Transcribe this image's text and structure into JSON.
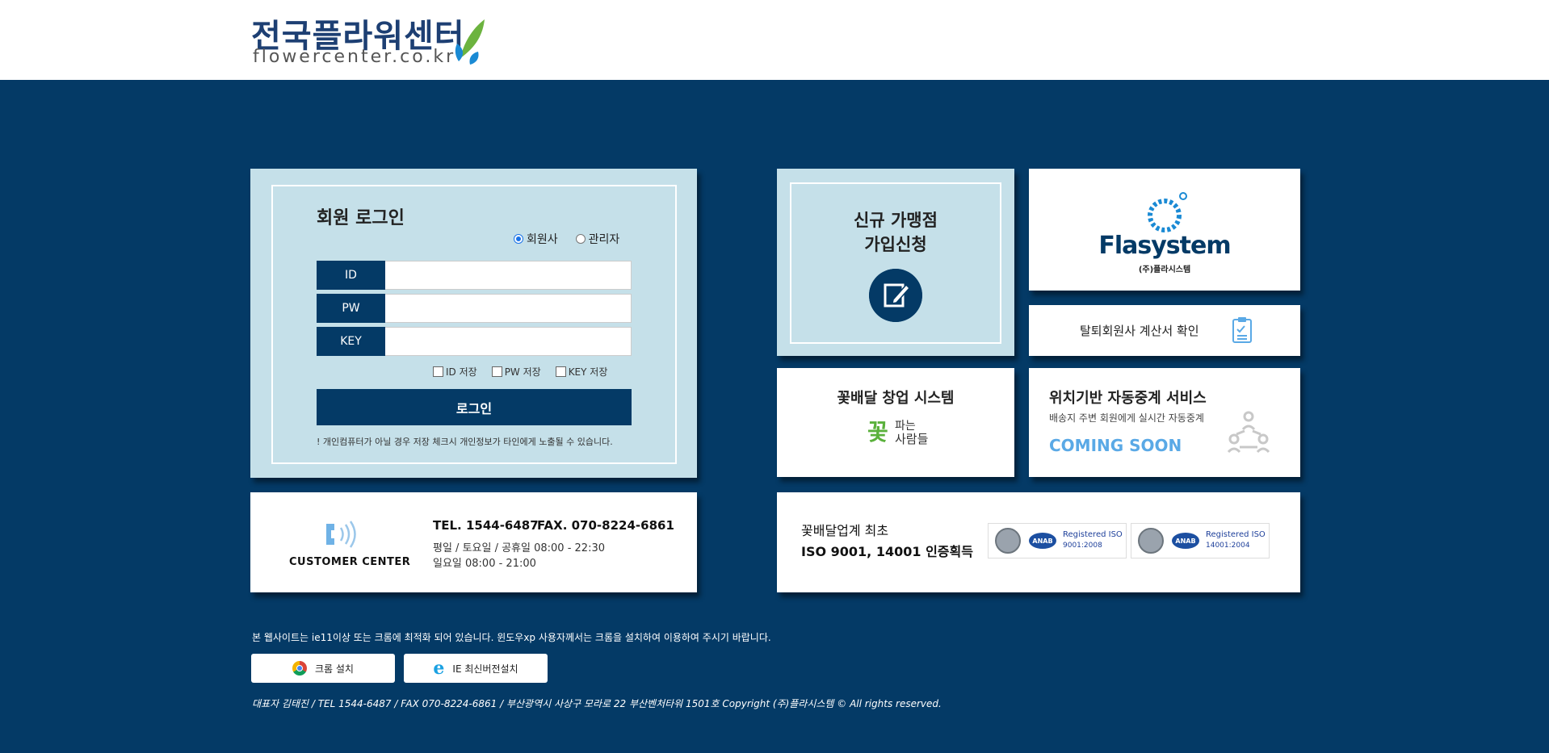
{
  "header": {
    "logo_ko": "전국플라워센터",
    "logo_en": "flowercenter.co.kr"
  },
  "login": {
    "title": "회원 로그인",
    "radio_member": "회원사",
    "radio_admin": "관리자",
    "selected_radio": "회원사",
    "id_label": "ID",
    "pw_label": "PW",
    "key_label": "KEY",
    "id_value": "",
    "pw_value": "",
    "key_value": "",
    "save_id": "ID 저장",
    "save_pw": "PW 저장",
    "save_key": "KEY 저장",
    "button": "로그인",
    "notice": "! 개인컴퓨터가 아닐 경우 저장 체크시 개인정보가 타인에게 노출될 수 있습니다."
  },
  "customer": {
    "label": "CUSTOMER CENTER",
    "tel": "TEL. 1544-6487",
    "fax": "FAX. 070-8224-6861",
    "hours1": "평일 / 토요일 / 공휴일 08:00 - 22:30",
    "hours2": "일요일 08:00 - 21:00"
  },
  "join": {
    "line1": "신규 가맹점",
    "line2": "가입신청"
  },
  "flasystem": {
    "name": "Flasystem",
    "sub": "(주)플라시스템"
  },
  "withdraw": {
    "label": "탈퇴회원사 계산서 확인"
  },
  "startup": {
    "title": "꽃배달 창업 시스템",
    "logo_big": "꽃",
    "logo_small1": "파는",
    "logo_small2": "사람들"
  },
  "location": {
    "title": "위치기반 자동중계 서비스",
    "subtitle": "배송지 주변 회원에게 실시간 자동중계",
    "status": "COMING SOON"
  },
  "iso": {
    "line1": "꽃배달업계 최초",
    "line2": "ISO 9001, 14001 인증획득",
    "badge1_title": "Registered ISO",
    "badge1_code": "9001:2008",
    "badge2_title": "Registered ISO",
    "badge2_code": "14001:2004",
    "anab": "ANAB"
  },
  "footer": {
    "notice": "본 웹사이트는 ie11이상 또는 크롬에 최적화 되어 있습니다. 윈도우xp 사용자께서는 크롬을 설치하여 이용하여 주시기 바랍니다.",
    "chrome_btn": "크롬 설치",
    "ie_btn": "IE 최신버전설치",
    "copyright": "대표자 김태진 / TEL 1544-6487 / FAX 070-8224-6861 / 부산광역시 사상구 모라로 22 부산벤처타워 1501호 Copyright (주)플라시스템 © All rights reserved."
  },
  "colors": {
    "navy": "#043a66",
    "light_panel": "#c5e0e9",
    "coming_soon": "#5aa9e6",
    "leaf_green": "#6cb33f",
    "leaf_blue": "#1a8ad4"
  }
}
